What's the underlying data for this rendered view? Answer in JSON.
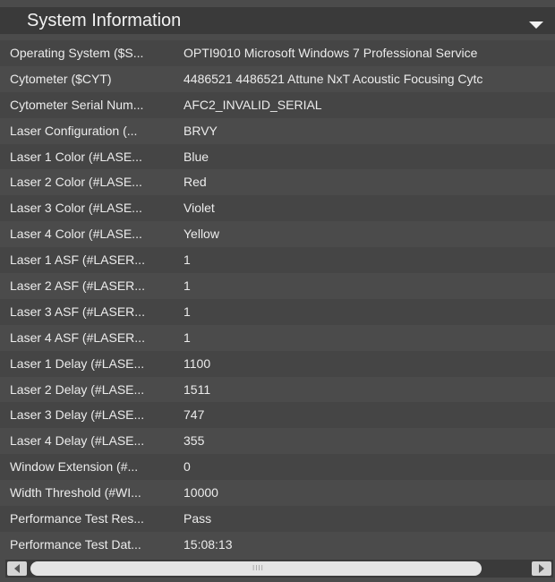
{
  "panel": {
    "title": "System Information",
    "collapse_icon": "chevron-down-icon",
    "colors": {
      "background": "#4b4b4b",
      "header": "#3a3a3a",
      "text": "#ececec"
    }
  },
  "properties": [
    {
      "name": "Operating System ($S...",
      "value": "OPTI9010 Microsoft Windows 7 Professional Service"
    },
    {
      "name": "Cytometer ($CYT)",
      "value": "4486521 4486521 Attune NxT Acoustic Focusing Cytc"
    },
    {
      "name": "Cytometer Serial Num...",
      "value": "AFC2_INVALID_SERIAL"
    },
    {
      "name": "Laser Configuration (...",
      "value": "BRVY"
    },
    {
      "name": "Laser 1 Color (#LASE...",
      "value": "Blue"
    },
    {
      "name": "Laser 2 Color (#LASE...",
      "value": "Red"
    },
    {
      "name": "Laser 3 Color (#LASE...",
      "value": "Violet"
    },
    {
      "name": "Laser 4 Color (#LASE...",
      "value": "Yellow"
    },
    {
      "name": "Laser 1 ASF (#LASER...",
      "value": "1"
    },
    {
      "name": "Laser 2 ASF (#LASER...",
      "value": "1"
    },
    {
      "name": "Laser 3 ASF (#LASER...",
      "value": "1"
    },
    {
      "name": "Laser 4 ASF (#LASER...",
      "value": "1"
    },
    {
      "name": "Laser 1 Delay (#LASE...",
      "value": "1100"
    },
    {
      "name": "Laser 2 Delay (#LASE...",
      "value": "1511"
    },
    {
      "name": "Laser 3 Delay (#LASE...",
      "value": "747"
    },
    {
      "name": "Laser 4 Delay (#LASE...",
      "value": "355"
    },
    {
      "name": "Window Extension (#...",
      "value": "0"
    },
    {
      "name": "Width Threshold (#WI...",
      "value": "10000"
    },
    {
      "name": "Performance Test Res...",
      "value": "Pass"
    },
    {
      "name": "Performance Test Dat...",
      "value": "15:08:13"
    }
  ],
  "scrollbar": {
    "left_icon": "arrow-left-icon",
    "right_icon": "arrow-right-icon",
    "grip": "IIII"
  }
}
